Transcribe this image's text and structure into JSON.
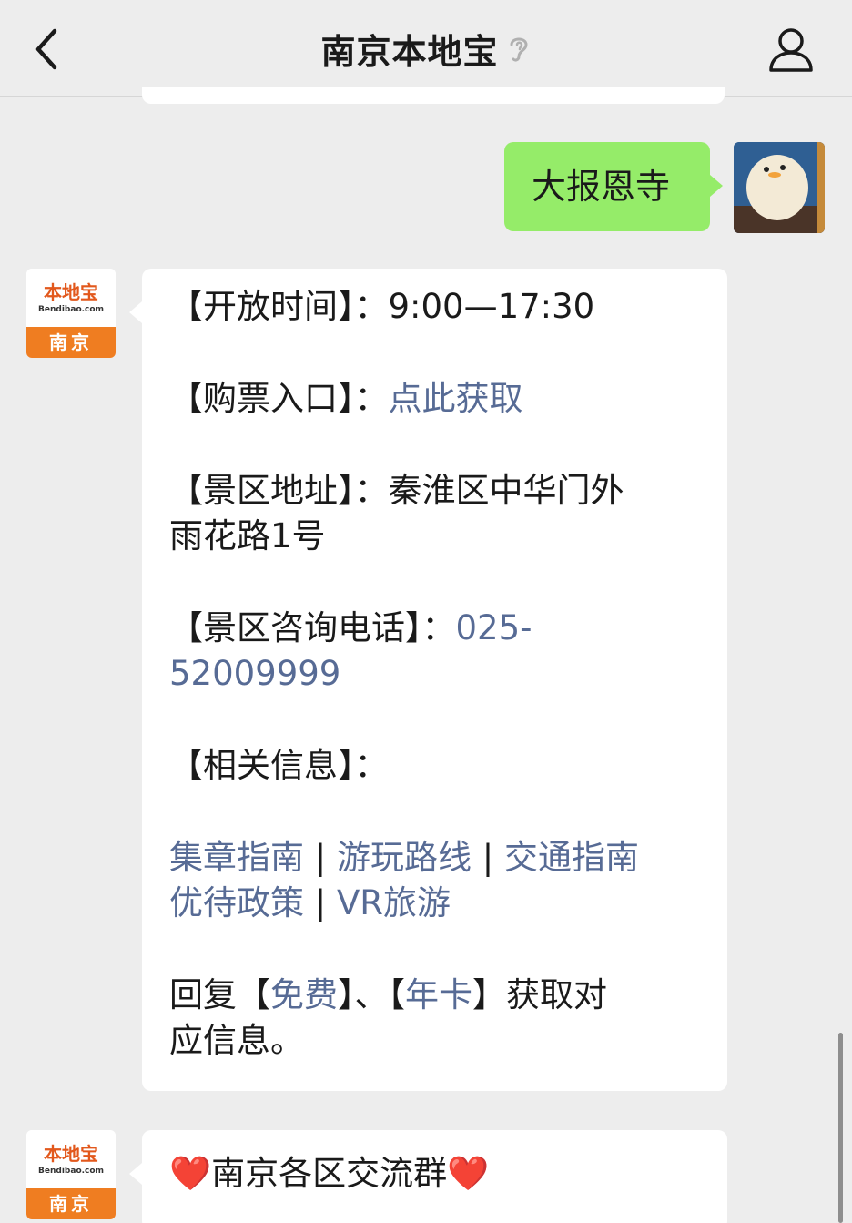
{
  "header": {
    "title": "南京本地宝",
    "back_icon": "chevron-left-icon",
    "ear_icon": "ear-icon",
    "profile_icon": "person-icon"
  },
  "messages": {
    "me_text": "大报恩寺",
    "bot_avatar": {
      "logo": "本地宝",
      "logo_sub": "Bendibao.com",
      "city": "南京"
    },
    "info": {
      "open_label": "【开放时间】：",
      "open_value": "9:00—17:30",
      "ticket_label": "【购票入口】：",
      "ticket_link": "点此获取",
      "address_label": "【景区地址】：",
      "address_value_line1": "秦淮区中华门外",
      "address_value_line2": "雨花路1号",
      "phone_label": "【景区咨询电话】：",
      "phone_value_line1": "025-",
      "phone_value_line2": "52009999",
      "related_label": "【相关信息】：",
      "links": {
        "stamp": "集章指南",
        "route": "游玩路线",
        "traffic": "交通指南",
        "discount": "优待政策",
        "vr": "VR旅游",
        "sep": " | "
      },
      "reply_prefix": "回复【",
      "reply_free": "免费",
      "reply_mid": "】、【",
      "reply_card": "年卡",
      "reply_suffix_line1": "】获取对",
      "reply_suffix_line2": "应信息。"
    },
    "group": {
      "heart": "❤️",
      "title": "南京各区交流群"
    }
  },
  "colors": {
    "link": "#576b95",
    "my_bubble": "#95ec69",
    "brand_orange": "#ef7d21"
  }
}
